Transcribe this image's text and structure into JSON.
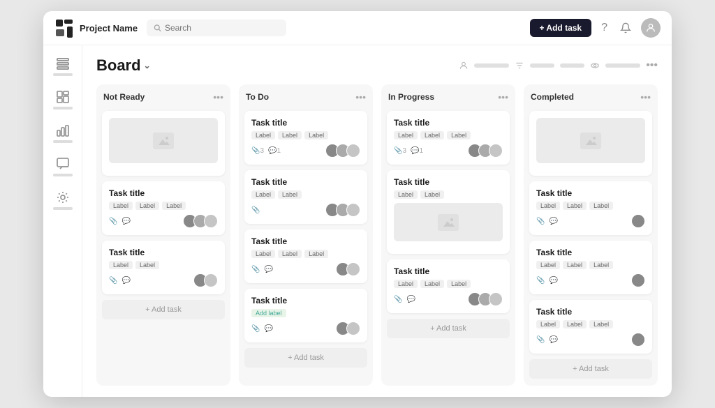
{
  "header": {
    "logo_text": "Project Name",
    "search_placeholder": "Search",
    "add_task_label": "+ Add task",
    "help_icon": "?",
    "notification_icon": "🔔"
  },
  "sidebar": {
    "items": [
      {
        "label": "List",
        "icon": "list"
      },
      {
        "label": "Board",
        "icon": "board"
      },
      {
        "label": "Chart",
        "icon": "chart"
      },
      {
        "label": "Chat",
        "icon": "chat"
      },
      {
        "label": "Settings",
        "icon": "settings"
      }
    ]
  },
  "board": {
    "title": "Board",
    "columns": [
      {
        "id": "not-ready",
        "title": "Not Ready",
        "cards": [
          {
            "has_image": true,
            "title": null,
            "labels": [],
            "meta": [],
            "avatars": 0
          },
          {
            "has_image": false,
            "title": "Task title",
            "labels": [
              "Label",
              "Label",
              "Label"
            ],
            "meta": [
              "attachment",
              "comment"
            ],
            "avatars": 3
          },
          {
            "has_image": false,
            "title": "Task title",
            "labels": [
              "Label",
              "Label"
            ],
            "meta": [
              "attachment",
              "comment"
            ],
            "avatars": 2
          }
        ],
        "add_task_label": "+ Add task"
      },
      {
        "id": "to-do",
        "title": "To Do",
        "cards": [
          {
            "has_image": false,
            "title": "Task title",
            "labels": [
              "Label",
              "Label",
              "Label"
            ],
            "meta": [
              "3",
              "1"
            ],
            "avatars": 3
          },
          {
            "has_image": false,
            "title": "Task title",
            "labels": [
              "Label",
              "Label"
            ],
            "meta": [
              "attachment"
            ],
            "avatars": 3
          },
          {
            "has_image": false,
            "title": "Task title",
            "labels": [
              "Label",
              "Label",
              "Label"
            ],
            "meta": [
              "attachment",
              "comment"
            ],
            "avatars": 2
          },
          {
            "has_image": false,
            "title": "Task title",
            "labels": [
              "Add label"
            ],
            "meta": [
              "attachment",
              "comment"
            ],
            "avatars": 2
          }
        ],
        "add_task_label": "+ Add task"
      },
      {
        "id": "in-progress",
        "title": "In Progress",
        "cards": [
          {
            "has_image": false,
            "title": "Task title",
            "labels": [
              "Label",
              "Label",
              "Label"
            ],
            "meta": [
              "3",
              "1"
            ],
            "avatars": 3
          },
          {
            "has_image": true,
            "title": "Task title",
            "labels": [
              "Label",
              "Label"
            ],
            "meta": [],
            "avatars": 0
          },
          {
            "has_image": false,
            "title": "Task title",
            "labels": [
              "Label",
              "Label",
              "Label"
            ],
            "meta": [
              "attachment",
              "comment"
            ],
            "avatars": 3
          }
        ],
        "add_task_label": "+ Add task"
      },
      {
        "id": "completed",
        "title": "Completed",
        "cards": [
          {
            "has_image": true,
            "title": null,
            "labels": [],
            "meta": [],
            "avatars": 0
          },
          {
            "has_image": false,
            "title": "Task title",
            "labels": [
              "Label",
              "Label",
              "Label"
            ],
            "meta": [
              "attachment",
              "comment"
            ],
            "avatars": 1
          },
          {
            "has_image": false,
            "title": "Task title",
            "labels": [
              "Label",
              "Label",
              "Label"
            ],
            "meta": [
              "attachment",
              "comment"
            ],
            "avatars": 1
          },
          {
            "has_image": false,
            "title": "Task title",
            "labels": [
              "Label",
              "Label",
              "Label"
            ],
            "meta": [
              "attachment",
              "comment"
            ],
            "avatars": 1
          }
        ],
        "add_task_label": "+ Add task"
      }
    ]
  }
}
